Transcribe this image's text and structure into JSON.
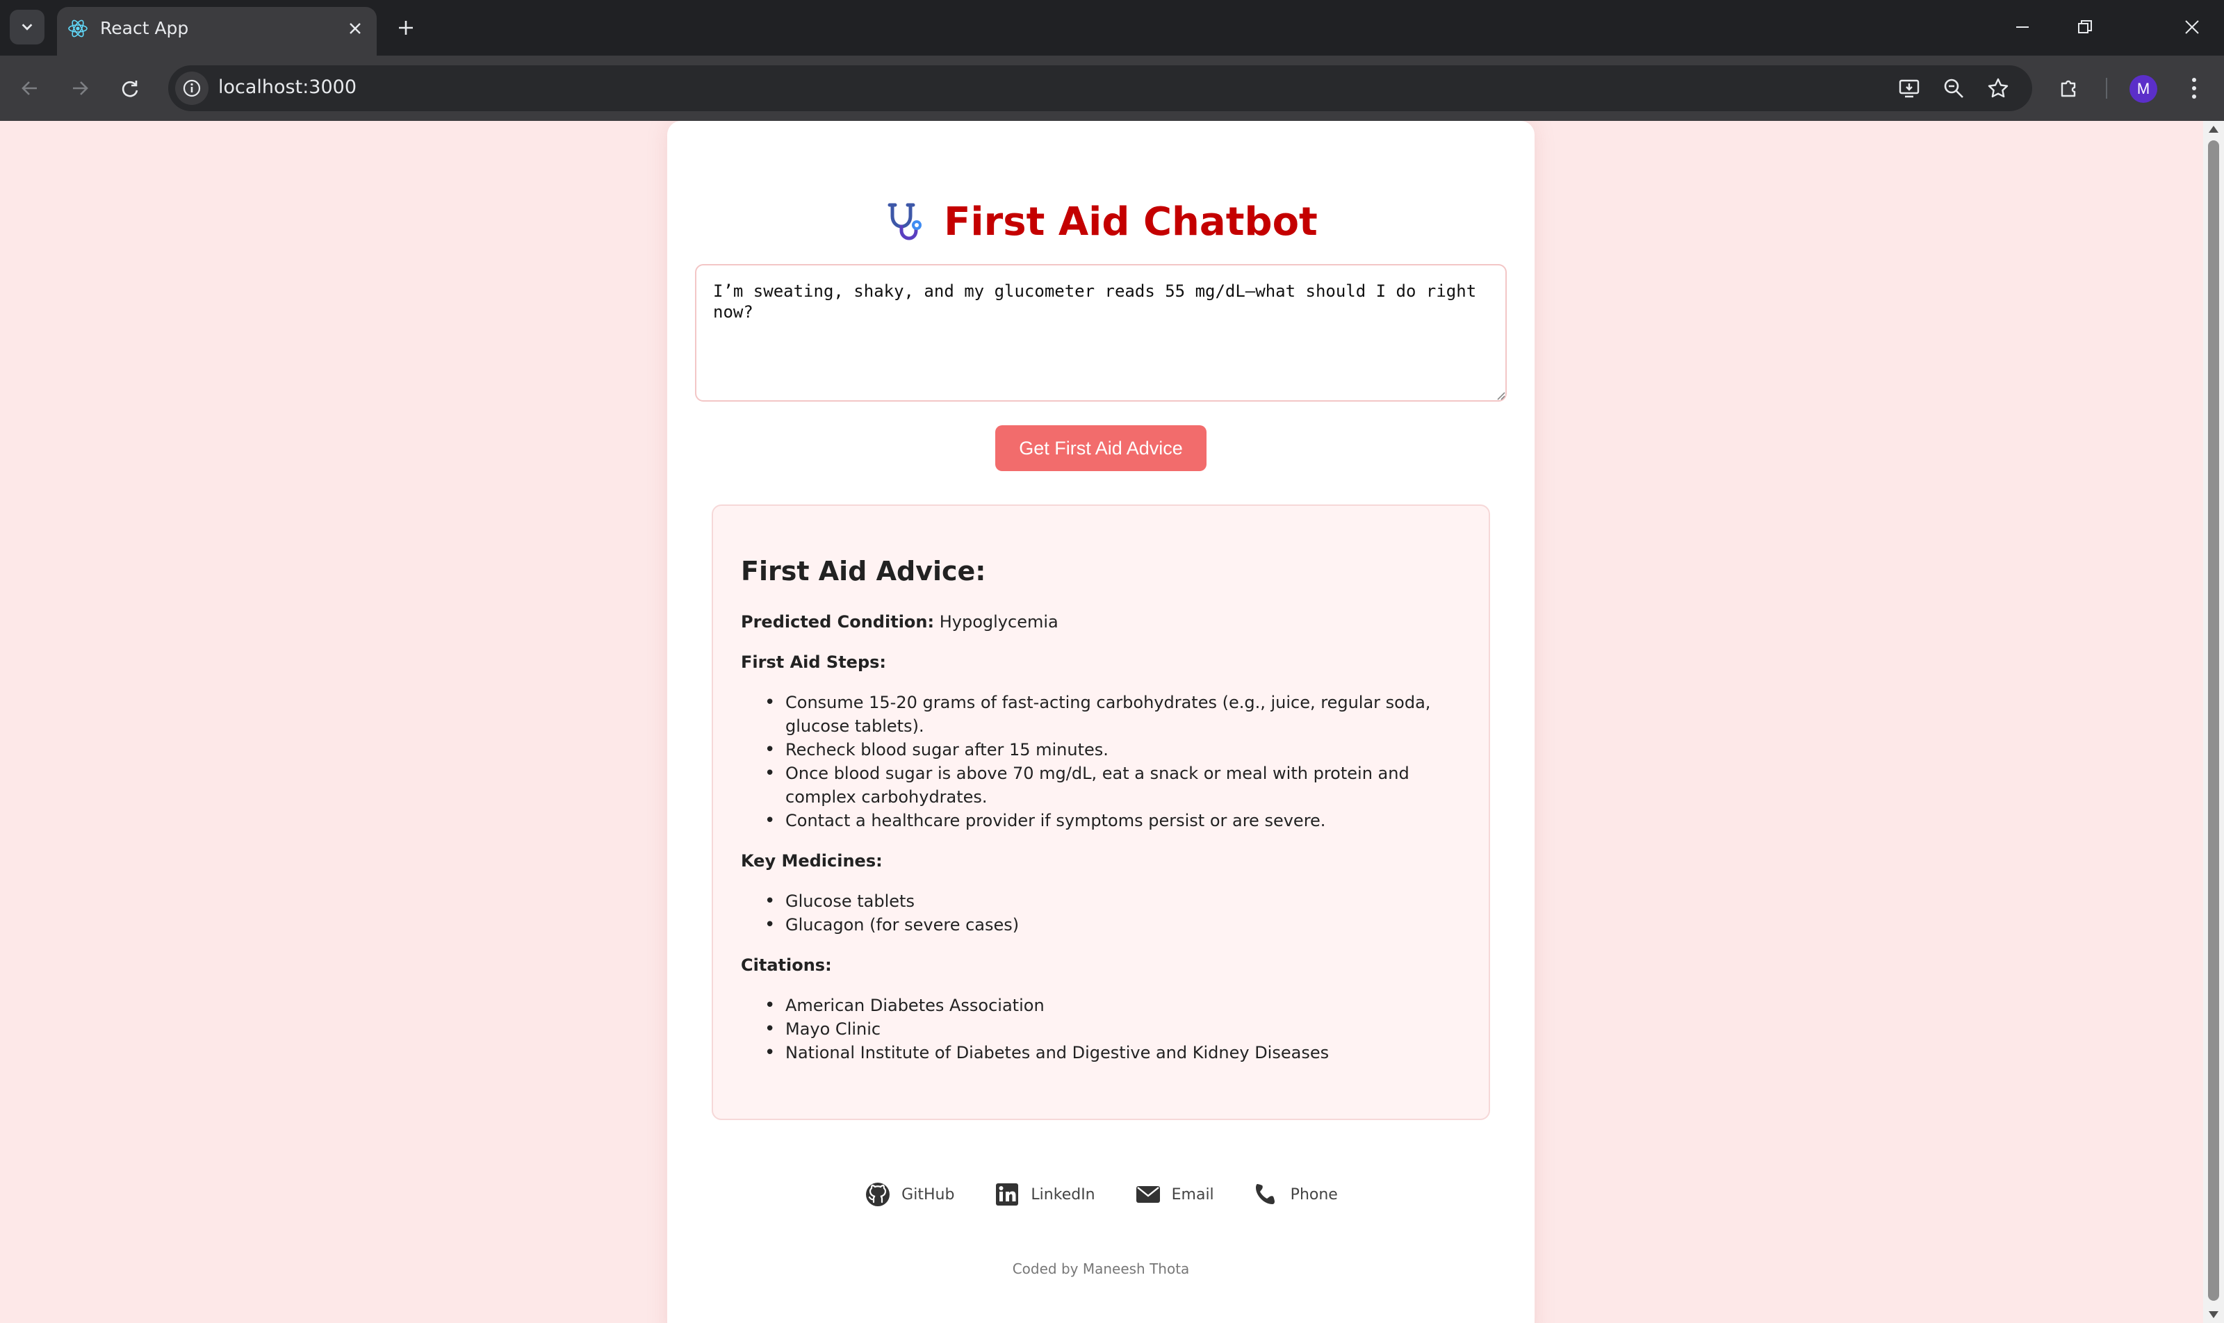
{
  "browser": {
    "tab_title": "React App",
    "url": "localhost:3000",
    "profile_initial": "M"
  },
  "app": {
    "title": "First Aid Chatbot",
    "query_text": "I’m sweating, shaky, and my glucometer reads 55 mg/dL—what should I do right now?",
    "button_label": "Get First Aid Advice"
  },
  "advice": {
    "heading": "First Aid Advice:",
    "condition_label": "Predicted Condition:",
    "condition_value": "Hypoglycemia",
    "steps_label": "First Aid Steps:",
    "steps": [
      "Consume 15-20 grams of fast-acting carbohydrates (e.g., juice, regular soda, glucose tablets).",
      "Recheck blood sugar after 15 minutes.",
      "Once blood sugar is above 70 mg/dL, eat a snack or meal with protein and complex carbohydrates.",
      "Contact a healthcare provider if symptoms persist or are severe."
    ],
    "medicines_label": "Key Medicines:",
    "medicines": [
      "Glucose tablets",
      "Glucagon (for severe cases)"
    ],
    "citations_label": "Citations:",
    "citations": [
      "American Diabetes Association",
      "Mayo Clinic",
      "National Institute of Diabetes and Digestive and Kidney Diseases"
    ]
  },
  "footer": {
    "links": {
      "github": "GitHub",
      "linkedin": "LinkedIn",
      "email": "Email",
      "phone": "Phone"
    },
    "credit": "Coded by Maneesh Thota"
  },
  "colors": {
    "title_red": "#c40000",
    "button_coral": "#f26c6c",
    "page_background": "#fde8e8",
    "advice_background": "#fff3f3"
  },
  "icons": {
    "title": "stethoscope-icon",
    "favicon": "react-icon"
  }
}
